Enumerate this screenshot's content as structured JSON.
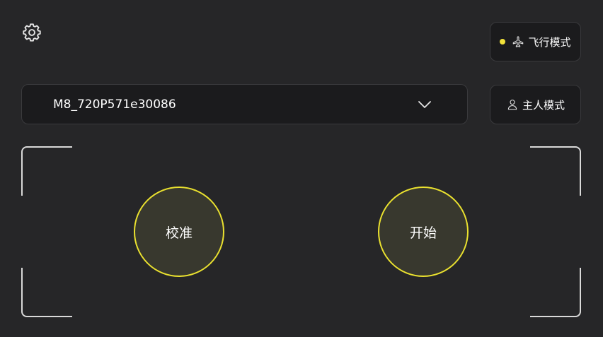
{
  "header": {
    "settings_icon": "gear-icon"
  },
  "mode_buttons": {
    "flight": {
      "label": "飞行模式",
      "icon": "airplane-icon",
      "indicator_color": "#f2e23a"
    },
    "owner": {
      "label": "主人模式",
      "icon": "person-icon"
    }
  },
  "device_select": {
    "value": "M8_720P571e30086",
    "icon": "chevron-down-icon"
  },
  "actions": {
    "calibrate_label": "校准",
    "start_label": "开始",
    "accent_color": "#eae12f"
  }
}
